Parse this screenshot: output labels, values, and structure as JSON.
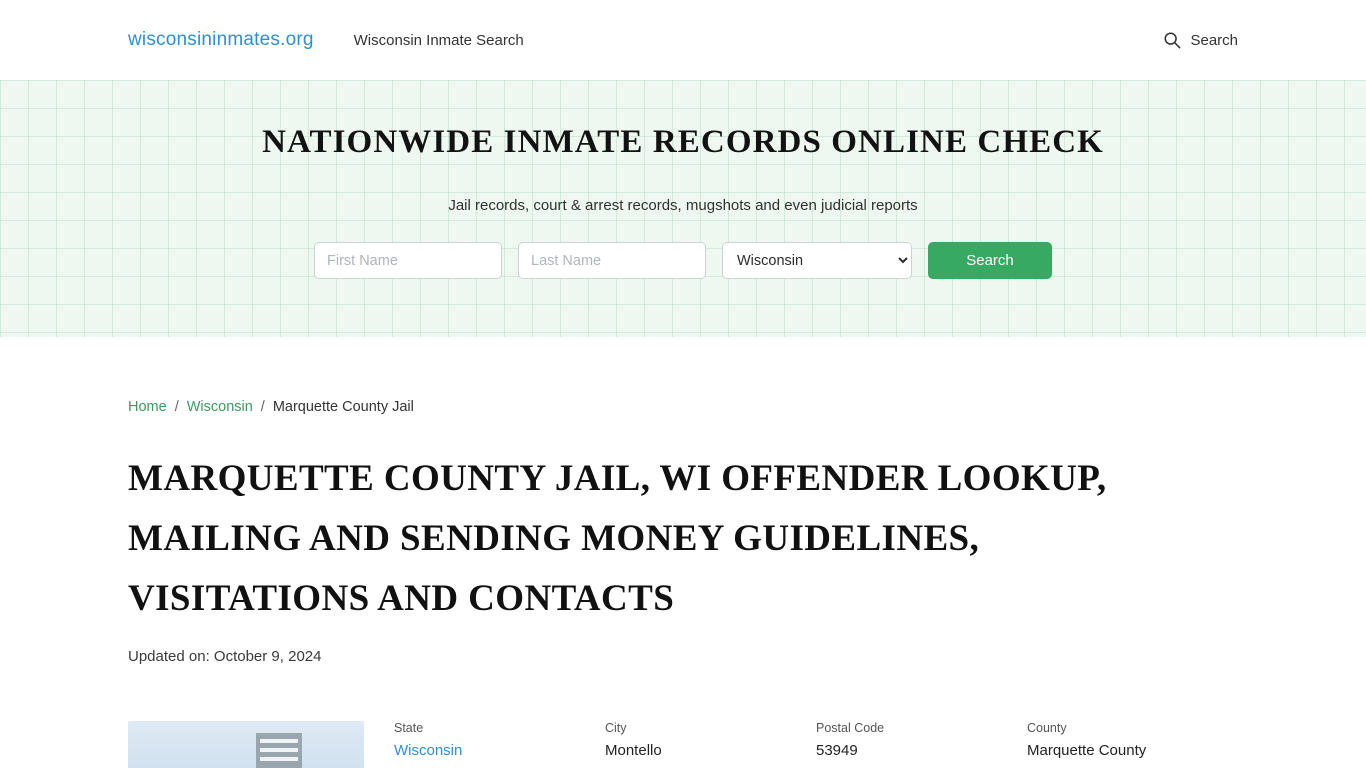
{
  "nav": {
    "brand": "wisconsininmates.org",
    "link": "Wisconsin Inmate Search",
    "search_label": "Search",
    "search_icon": "search-icon"
  },
  "hero": {
    "heading": "NATIONWIDE INMATE RECORDS ONLINE CHECK",
    "subheading": "Jail records, court & arrest records, mugshots and even judicial reports",
    "first_name_placeholder": "First Name",
    "first_name_value": "",
    "last_name_placeholder": "Last Name",
    "last_name_value": "",
    "state_selected": "Wisconsin",
    "state_options": [
      "Wisconsin"
    ],
    "search_button": "Search",
    "button_color": "#37a963"
  },
  "breadcrumb": {
    "home": "Home",
    "state": "Wisconsin",
    "current": "Marquette County Jail",
    "separator": "/"
  },
  "main": {
    "title": "MARQUETTE COUNTY JAIL, WI OFFENDER LOOKUP, MAILING AND SENDING MONEY GUIDELINES, VISITATIONS AND CONTACTS",
    "updated": "Updated on: October 9, 2024"
  },
  "facility": {
    "fields": [
      {
        "label": "State",
        "value": "Wisconsin",
        "is_link": true
      },
      {
        "label": "City",
        "value": "Montello",
        "is_link": false
      },
      {
        "label": "Postal Code",
        "value": "53949",
        "is_link": false
      },
      {
        "label": "County",
        "value": "Marquette County",
        "is_link": false
      }
    ]
  }
}
